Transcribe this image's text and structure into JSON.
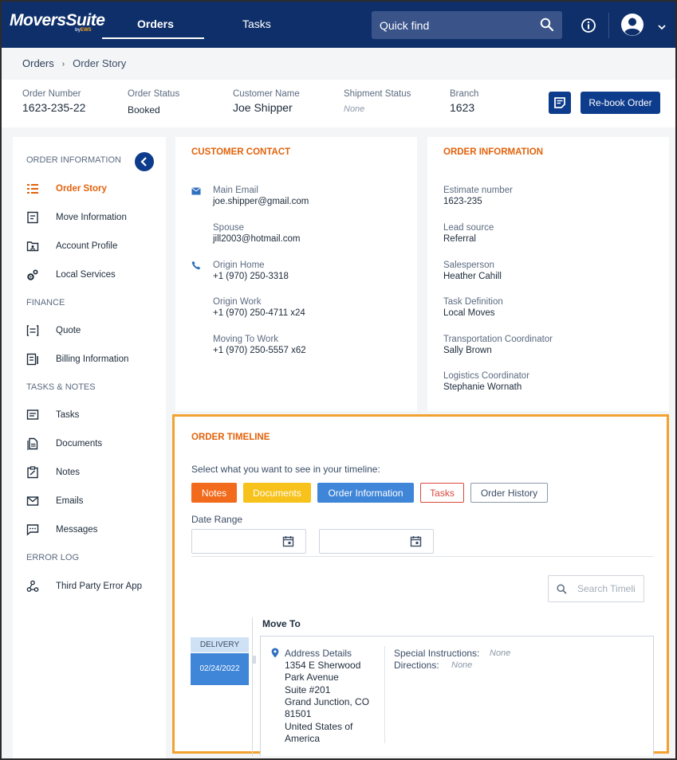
{
  "app": {
    "logo": "MoversSuite",
    "logo_sub_prefix": "by",
    "logo_sub_brand": "EWS",
    "nav_tabs": [
      {
        "label": "Orders",
        "active": true
      },
      {
        "label": "Tasks",
        "active": false
      }
    ],
    "quick_find_placeholder": "Quick find",
    "icons": [
      "search-icon",
      "info-icon",
      "user-avatar-icon",
      "chevron-down-icon"
    ],
    "colors": {
      "topbar": "#0e2f6a",
      "accent": "#e2620c",
      "primary_button": "#0e3c8c",
      "timeline_highlight": "#f2a22f"
    }
  },
  "breadcrumb": [
    "Orders",
    "Order Story"
  ],
  "header": {
    "order_number_label": "Order Number",
    "order_number": "1623-235-22",
    "order_status_label": "Order Status",
    "order_status": "Booked",
    "customer_name_label": "Customer Name",
    "customer_name": "Joe Shipper",
    "shipment_status_label": "Shipment Status",
    "shipment_status": "None",
    "branch_label": "Branch",
    "branch": "1623",
    "rebook_label": "Re-book Order"
  },
  "sidebar": {
    "sections": [
      {
        "title": "ORDER INFORMATION",
        "items": [
          {
            "label": "Order Story",
            "icon": "order-story-icon",
            "active": true
          },
          {
            "label": "Move Information",
            "icon": "move-information-icon",
            "active": false
          },
          {
            "label": "Account Profile",
            "icon": "account-profile-icon",
            "active": false
          },
          {
            "label": "Local Services",
            "icon": "local-services-icon",
            "active": false
          }
        ]
      },
      {
        "title": "FINANCE",
        "items": [
          {
            "label": "Quote",
            "icon": "quote-icon",
            "active": false
          },
          {
            "label": "Billing Information",
            "icon": "billing-icon",
            "active": false
          }
        ]
      },
      {
        "title": "TASKS & NOTES",
        "items": [
          {
            "label": "Tasks",
            "icon": "tasks-icon",
            "active": false
          },
          {
            "label": "Documents",
            "icon": "documents-icon",
            "active": false
          },
          {
            "label": "Notes",
            "icon": "notes-icon",
            "active": false
          },
          {
            "label": "Emails",
            "icon": "emails-icon",
            "active": false
          },
          {
            "label": "Messages",
            "icon": "messages-icon",
            "active": false
          }
        ]
      },
      {
        "title": "ERROR LOG",
        "items": [
          {
            "label": "Third Party Error App",
            "icon": "error-app-icon",
            "active": false
          }
        ]
      }
    ]
  },
  "customer_contact": {
    "title": "CUSTOMER CONTACT",
    "fields": [
      {
        "label": "Main Email",
        "value": "joe.shipper@gmail.com",
        "icon": "mail-icon"
      },
      {
        "label": "Spouse",
        "value": "jill2003@hotmail.com",
        "icon": ""
      },
      {
        "label": "Origin Home",
        "value": "+1 (970) 250-3318",
        "icon": "phone-icon"
      },
      {
        "label": "Origin Work",
        "value": "+1 (970) 250-4711 x24",
        "icon": ""
      },
      {
        "label": "Moving To Work",
        "value": "+1 (970) 250-5557 x62",
        "icon": ""
      }
    ]
  },
  "order_information": {
    "title": "ORDER INFORMATION",
    "fields": [
      {
        "label": "Estimate number",
        "value": "1623-235"
      },
      {
        "label": "Lead source",
        "value": "Referral"
      },
      {
        "label": "Salesperson",
        "value": "Heather Cahill"
      },
      {
        "label": "Task Definition",
        "value": "Local Moves"
      },
      {
        "label": "Transportation Coordinator",
        "value": "Sally Brown"
      },
      {
        "label": "Logistics Coordinator",
        "value": "Stephanie Wornath"
      }
    ]
  },
  "timeline": {
    "title": "ORDER TIMELINE",
    "subtitle": "Select what you want to see in your timeline:",
    "filters": [
      "Notes",
      "Documents",
      "Order Information",
      "Tasks",
      "Order History"
    ],
    "date_range_label": "Date Range",
    "search_placeholder": "Search Timeli",
    "entry": {
      "heading": "Move To",
      "tag": "DELIVERY",
      "date": "02/24/2022",
      "address_label": "Address Details",
      "address_lines": [
        "1354 E Sherwood",
        "Park Avenue",
        "Suite #201",
        "Grand Junction, CO",
        "81501",
        "United States of",
        "America"
      ],
      "special_instructions_label": "Special Instructions:",
      "special_instructions": "None",
      "directions_label": "Directions:",
      "directions": "None"
    }
  }
}
